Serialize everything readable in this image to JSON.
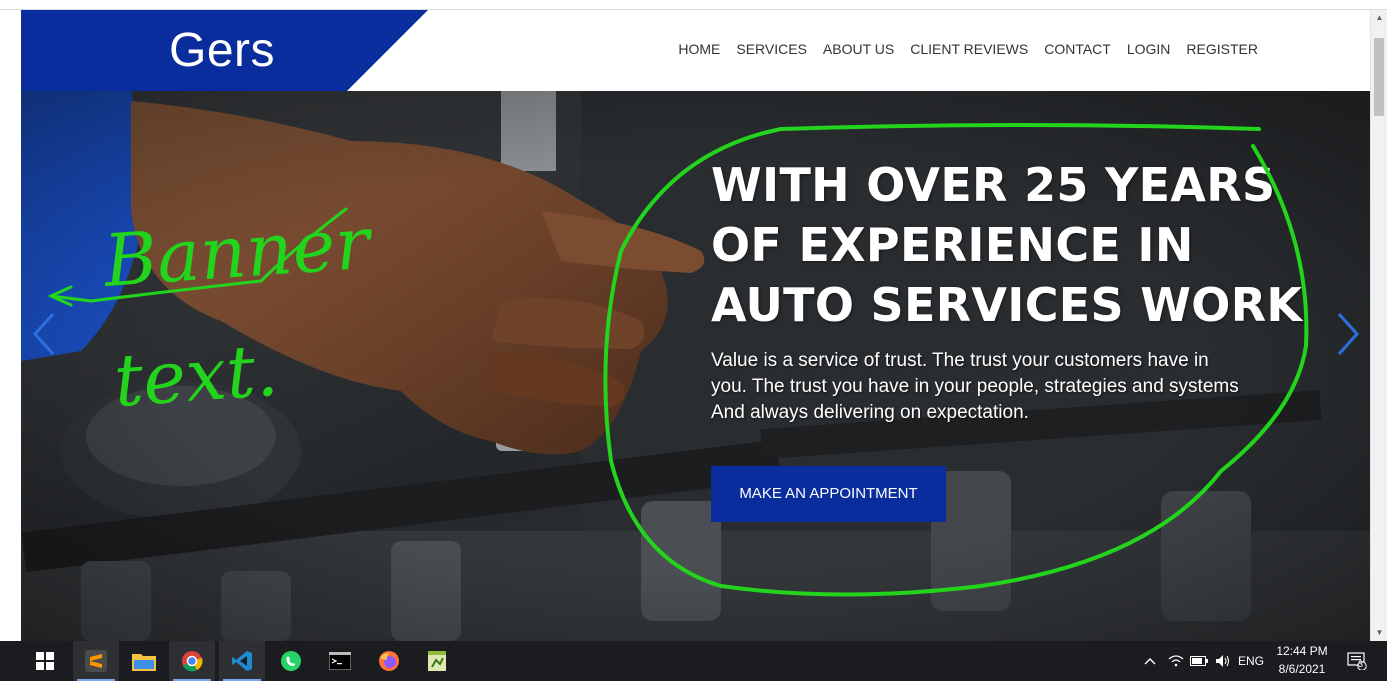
{
  "site": {
    "logo": "Gers",
    "nav": [
      "HOME",
      "SERVICES",
      "ABOUT US",
      "CLIENT REVIEWS",
      "CONTACT",
      "LOGIN",
      "REGISTER"
    ]
  },
  "hero": {
    "title_lines": [
      "WITH OVER 25 YEARS",
      "OF EXPERIENCE IN",
      "AUTO SERVICES WORK"
    ],
    "subtitle_lines": [
      "Value is a service of trust. The trust your customers have in",
      "you. The trust you have in your people, strategies and systems",
      "And always delivering on expectation."
    ],
    "cta": "MAKE AN APPOINTMENT",
    "annotation_text": "Banner text."
  },
  "colors": {
    "brand_blue": "#0a2d9e",
    "annotation_green": "#22d41c",
    "arrow_blue": "#2d6fe0"
  },
  "taskbar": {
    "apps": [
      "windows-start-icon",
      "sublime-text-icon",
      "file-explorer-icon",
      "chrome-icon",
      "vscode-icon",
      "whatsapp-icon",
      "terminal-icon",
      "firefox-icon",
      "notepad-plus-icon"
    ],
    "language": "ENG",
    "time": "12:44 PM",
    "date": "8/6/2021",
    "notifications": "3"
  }
}
